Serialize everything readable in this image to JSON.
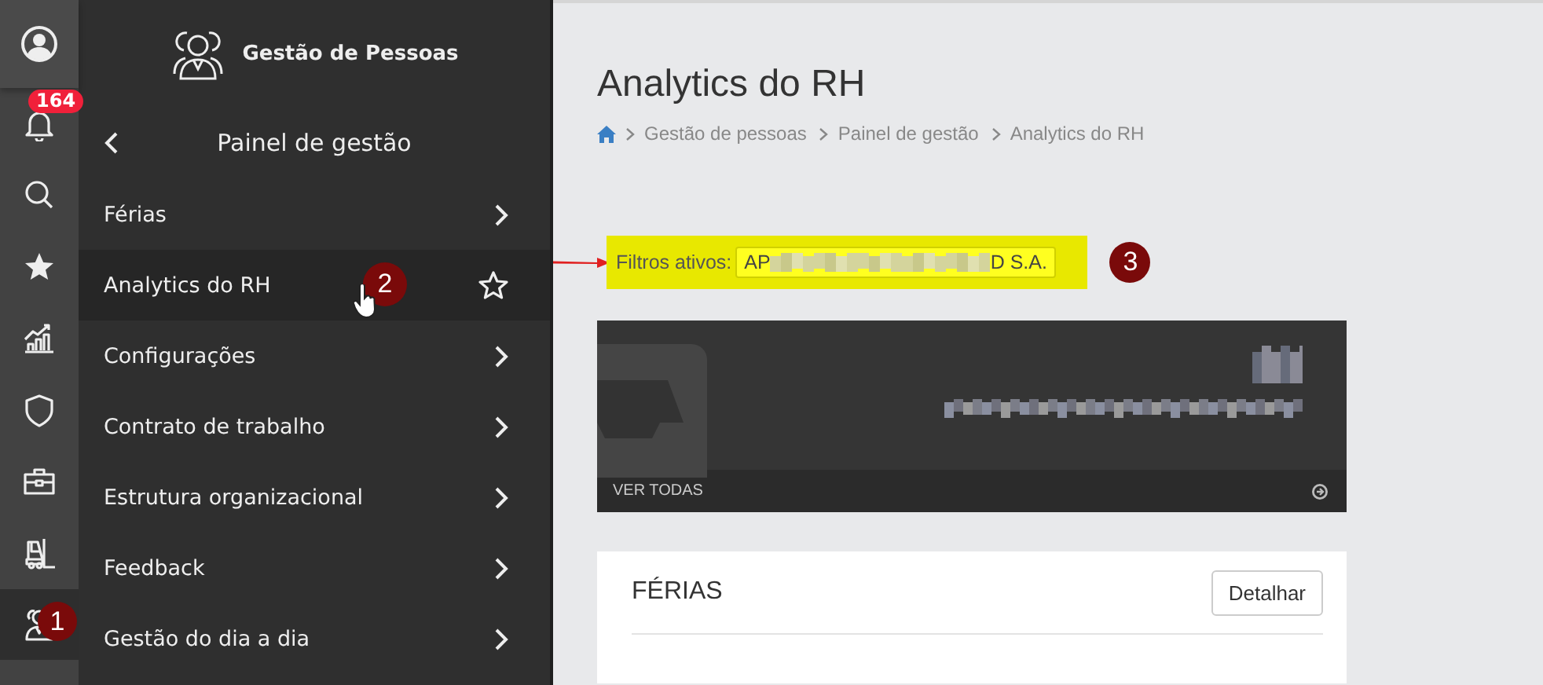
{
  "rail": {
    "notification_count": "164",
    "items": [
      {
        "kind": "bell",
        "selected": false
      },
      {
        "kind": "search",
        "selected": false
      },
      {
        "kind": "star",
        "selected": false
      },
      {
        "kind": "chart",
        "selected": false
      },
      {
        "kind": "shield",
        "selected": false
      },
      {
        "kind": "briefcase",
        "selected": false
      },
      {
        "kind": "forklift",
        "selected": false
      },
      {
        "kind": "people",
        "selected": true
      }
    ]
  },
  "module": {
    "title": "Gestão de Pessoas"
  },
  "menu": {
    "back_title": "Painel de gestão",
    "items": [
      {
        "label": "Férias",
        "selected": false
      },
      {
        "label": "Analytics do RH",
        "selected": true
      },
      {
        "label": "Configurações",
        "selected": false
      },
      {
        "label": "Contrato de trabalho",
        "selected": false
      },
      {
        "label": "Estrutura organizacional",
        "selected": false
      },
      {
        "label": "Feedback",
        "selected": false
      },
      {
        "label": "Gestão do dia a dia",
        "selected": false
      }
    ]
  },
  "page": {
    "title": "Analytics do RH",
    "breadcrumb": [
      "Gestão de pessoas",
      "Painel de gestão",
      "Analytics do RH"
    ]
  },
  "filters": {
    "label": "Filtros ativos:",
    "value_start": "AP",
    "value_end": "D S.A."
  },
  "widget": {
    "footer": "VER TODAS"
  },
  "card": {
    "title": "FÉRIAS",
    "button": "Detalhar"
  },
  "annotations": [
    "1",
    "2",
    "3"
  ]
}
